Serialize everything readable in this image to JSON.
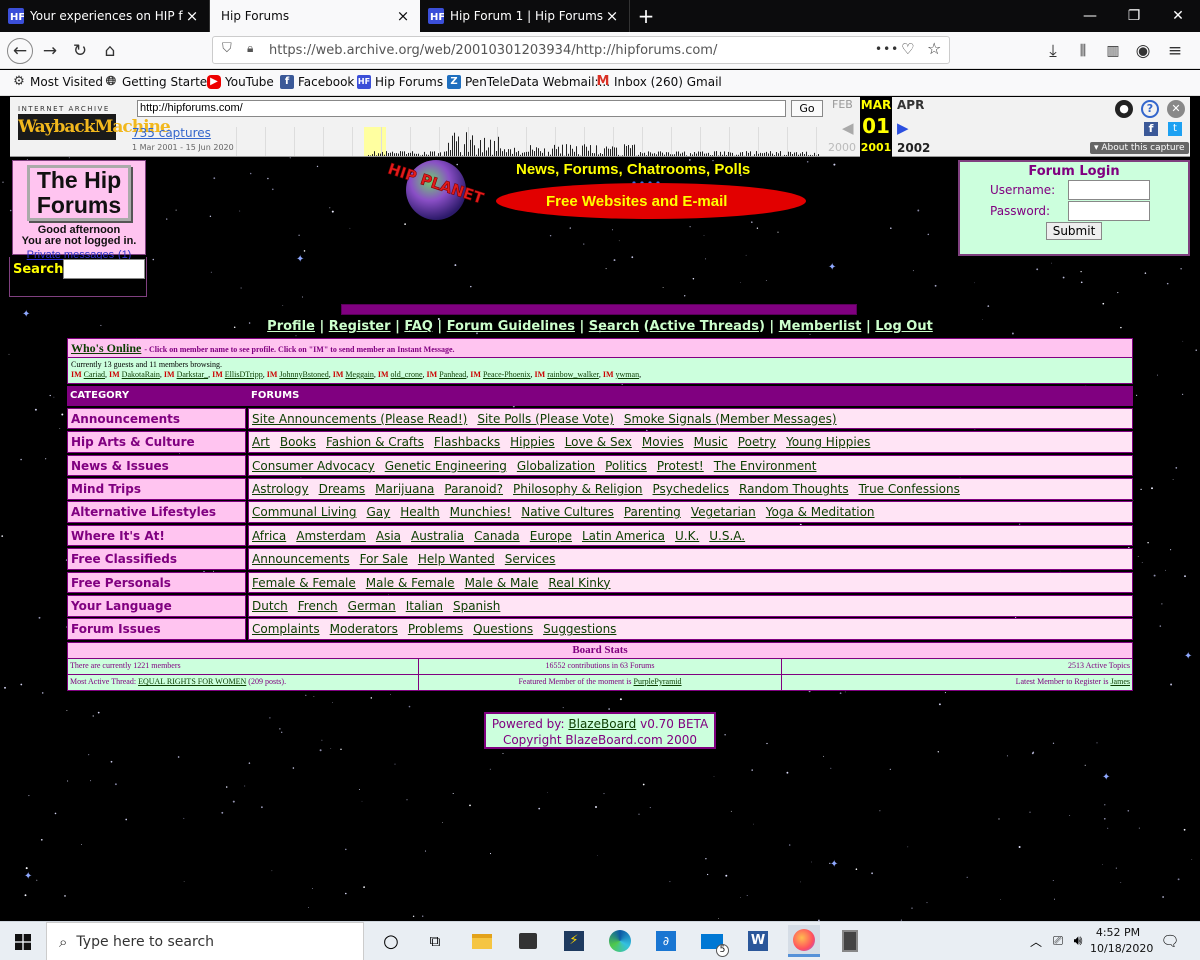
{
  "browser": {
    "tabs": [
      {
        "title": "Your experiences on HIP forum",
        "close": "×"
      },
      {
        "title": "Hip Forums",
        "close": "×"
      },
      {
        "title": "Hip Forum 1 | Hip Forums",
        "close": "×"
      }
    ],
    "new_tab": "+",
    "url": "https://web.archive.org/web/20010301203934/http://hipforums.com/",
    "url_host": "web.archive.org",
    "page_actions": "•••",
    "bookmarks": [
      {
        "label": "Most Visited"
      },
      {
        "label": "Getting Started"
      },
      {
        "label": "YouTube"
      },
      {
        "label": "Facebook"
      },
      {
        "label": "Hip Forums"
      },
      {
        "label": "PenTeleData Webmail:..."
      },
      {
        "label": "Inbox (260)  Gmail"
      }
    ]
  },
  "wayback": {
    "logo_small": "INTERNET ARCHIVE",
    "logo_big": "WaybackMachine",
    "url_value": "http://hipforums.com/",
    "go": "Go",
    "captures": "735 captures",
    "range": "1 Mar 2001 - 15 Jun 2020",
    "months": {
      "prev": "FEB",
      "cur": "MAR",
      "next": "APR"
    },
    "day": "01",
    "years": {
      "prev": "2000",
      "cur": "2001",
      "next": "2002"
    },
    "about": "▾ About this capture"
  },
  "site": {
    "logo_line1": "The Hip",
    "logo_line2": "Forums",
    "greeting": "Good afternoon",
    "login_status": "You are not logged in.",
    "private_messages": "Private messages",
    "private_count": "(1)",
    "search_label": "Search",
    "banner_top": "News, Forums, Chatrooms, Polls",
    "banner_bottom": "Free Websites and E-mail",
    "login": {
      "title": "Forum Login",
      "username": "Username:",
      "password": "Password:",
      "submit": "Submit"
    },
    "nav": [
      "Profile",
      "Register",
      "FAQ",
      "Forum Guidelines",
      "Search",
      "Active Threads",
      "Memberlist",
      "Log Out"
    ],
    "whos_online": "Who's Online",
    "whos_online_note": "- Click on member name to see profile. Click on \"IM\" to send member an Instant Message.",
    "browsing": "Currently 13 guests and 11 members browsing.",
    "im": "IM",
    "members": [
      "Cariad",
      "DakotaRain",
      "Darkstar_",
      "EllisDTripp",
      "JohnnyBstoned",
      "Meggain",
      "old_crone",
      "Panhead",
      "Peace-Phoenix",
      "rainbow_walker",
      "ywman"
    ],
    "col_category": "CATEGORY",
    "col_forums": "FORUMS",
    "categories": [
      {
        "name": "Announcements",
        "forums": [
          "Site Announcements (Please Read!)",
          "Site Polls (Please Vote)",
          "Smoke Signals (Member Messages)"
        ]
      },
      {
        "name": "Hip Arts & Culture",
        "forums": [
          "Art",
          "Books",
          "Fashion & Crafts",
          "Flashbacks",
          "Hippies",
          "Love & Sex",
          "Movies",
          "Music",
          "Poetry",
          "Young Hippies"
        ]
      },
      {
        "name": "News & Issues",
        "forums": [
          "Consumer Advocacy",
          "Genetic Engineering",
          "Globalization",
          "Politics",
          "Protest!",
          "The Environment"
        ]
      },
      {
        "name": "Mind Trips",
        "forums": [
          "Astrology",
          "Dreams",
          "Marijuana",
          "Paranoid?",
          "Philosophy & Religion",
          "Psychedelics",
          "Random Thoughts",
          "True Confessions"
        ]
      },
      {
        "name": "Alternative Lifestyles",
        "forums": [
          "Communal Living",
          "Gay",
          "Health",
          "Munchies!",
          "Native Cultures",
          "Parenting",
          "Vegetarian",
          "Yoga & Meditation"
        ]
      },
      {
        "name": "Where It's At!",
        "forums": [
          "Africa",
          "Amsterdam",
          "Asia",
          "Australia",
          "Canada",
          "Europe",
          "Latin America",
          "U.K.",
          "U.S.A."
        ]
      },
      {
        "name": "Free Classifieds",
        "forums": [
          "Announcements",
          "For Sale",
          "Help Wanted",
          "Services"
        ]
      },
      {
        "name": "Free Personals",
        "forums": [
          "Female & Female",
          "Male & Female",
          "Male & Male",
          "Real Kinky"
        ]
      },
      {
        "name": "Your Language",
        "forums": [
          "Dutch",
          "French",
          "German",
          "Italian",
          "Spanish"
        ]
      },
      {
        "name": "Forum Issues",
        "forums": [
          "Complaints",
          "Moderators",
          "Problems",
          "Questions",
          "Suggestions"
        ]
      }
    ],
    "stats": {
      "title": "Board Stats",
      "members": "There are currently 1221 members",
      "contributions": "16552 contributions in 63 Forums",
      "topics": "2513 Active Topics",
      "most_active_prefix": "Most Active Thread:",
      "most_active_link": "EQUAL RIGHTS FOR WOMEN",
      "most_active_suffix": "(209 posts).",
      "featured_prefix": "Featured Member of the moment is",
      "featured_link": "PurplePyramid",
      "latest_prefix": "Latest Member to Register is",
      "latest_link": "James"
    },
    "powered_prefix": "Powered by:",
    "powered_link": "BlazeBoard",
    "powered_version": "v0.70 BETA",
    "copyright": "Copyright BlazeBoard.com 2000"
  },
  "taskbar": {
    "search_placeholder": "Type here to search",
    "time": "4:52 PM",
    "date": "10/18/2020",
    "badge": "5"
  },
  "colors": {
    "accent": "#800080",
    "link": "#0b3d00",
    "pink": "#ffc4f0",
    "mint": "#ccffdd"
  }
}
